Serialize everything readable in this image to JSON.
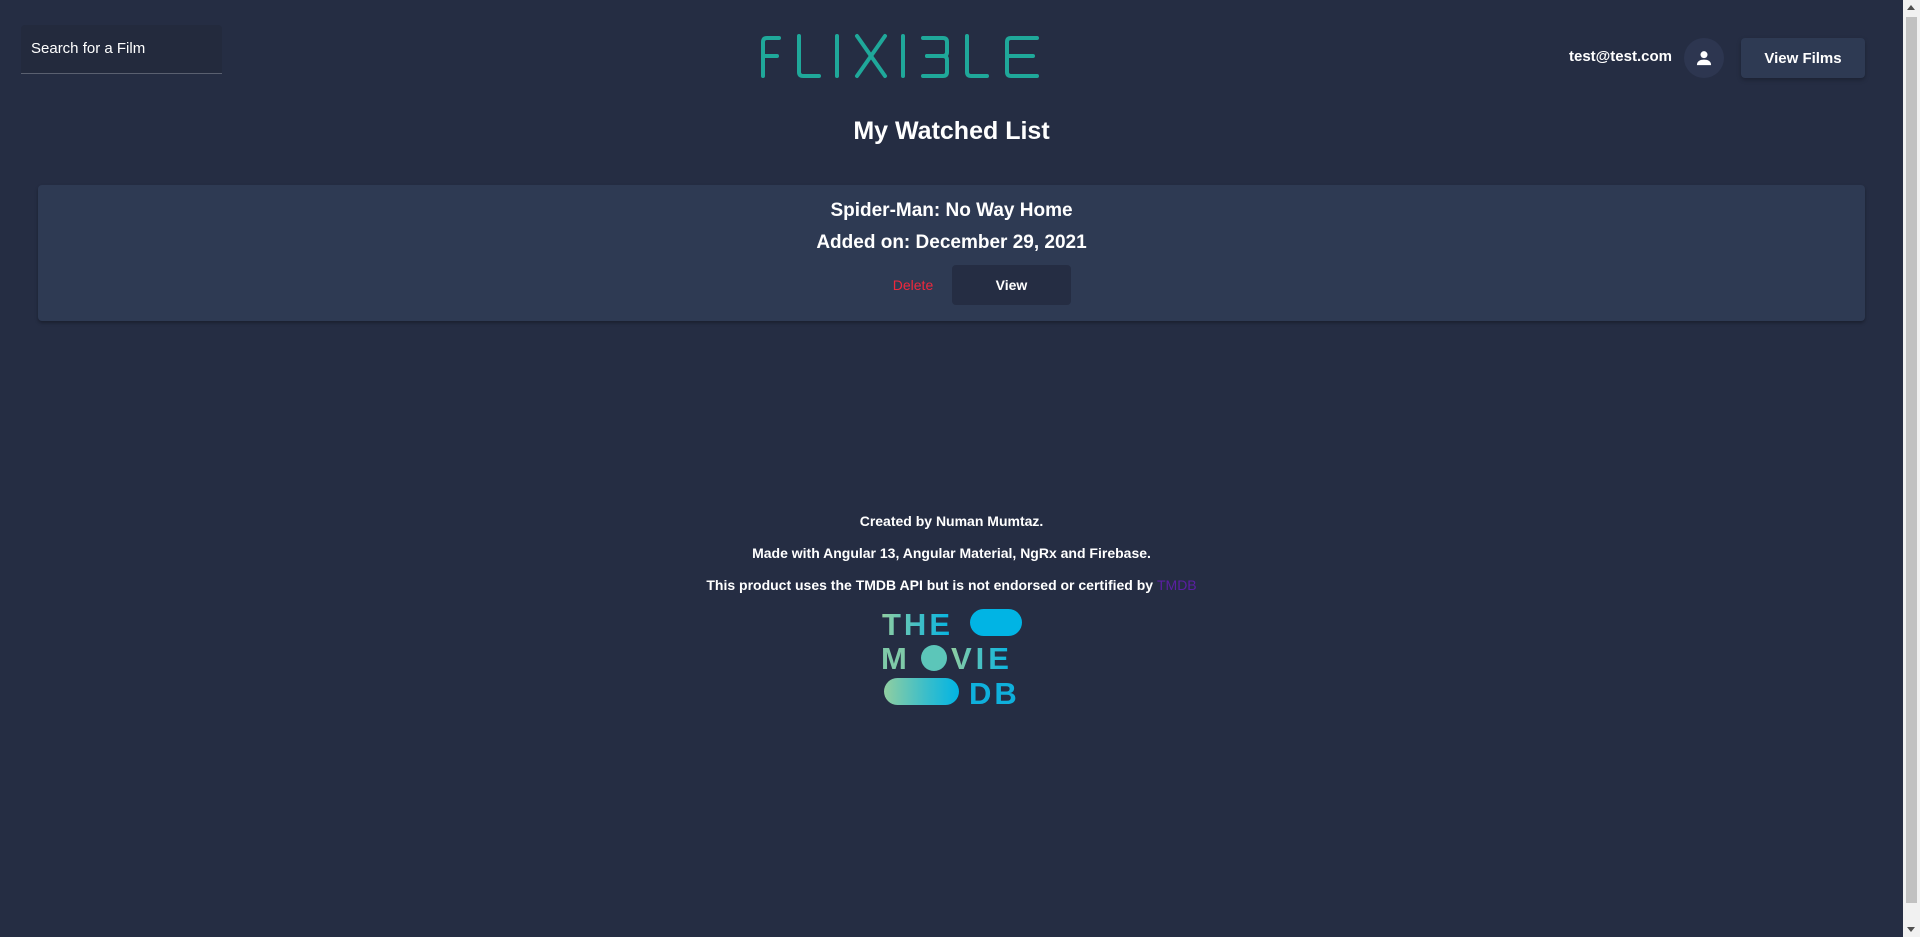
{
  "header": {
    "search_placeholder": "Search for a Film",
    "logo_text": "FLIXIBLE",
    "user_email": "test@test.com",
    "view_films_label": "View Films"
  },
  "main": {
    "title": "My Watched List",
    "items": [
      {
        "title": "Spider-Man: No Way Home",
        "added_on": "Added on: December 29, 2021",
        "delete_label": "Delete",
        "view_label": "View"
      }
    ]
  },
  "footer": {
    "credit": "Created by Numan Mumtaz.",
    "made_with": "Made with Angular 13, Angular Material, NgRx and Firebase.",
    "tmdb_notice": "This product uses the TMDB API but is not endorsed or certified by",
    "tmdb_link": "TMDB",
    "tmdb_logo_text": "THE MOVIE DB"
  },
  "colors": {
    "background": "#252d43",
    "card": "#2e3a53",
    "accent_teal": "#1fa89a",
    "delete_red": "#f0283c",
    "link_purple": "#5b1fa3"
  },
  "icons": {
    "avatar": "person-icon"
  }
}
